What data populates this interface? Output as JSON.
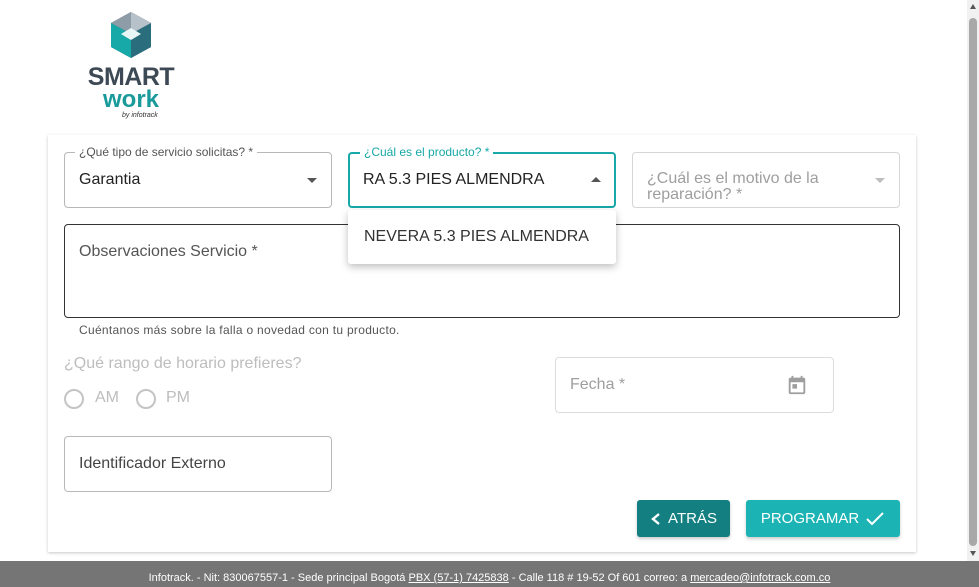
{
  "logo": {
    "line1": "SMART",
    "line2": "work",
    "line3": "by infotrack"
  },
  "form": {
    "service_type": {
      "label": "¿Qué tipo de servicio solicitas? *",
      "value": "Garantia"
    },
    "product": {
      "label": "¿Cuál es el producto? *",
      "value": "RA 5.3 PIES ALMENDRA"
    },
    "reason": {
      "placeholder": "¿Cuál es el motivo de la reparación? *"
    },
    "product_options": [
      "NEVERA 5.3 PIES ALMENDRA"
    ],
    "observations": {
      "placeholder": "Observaciones Servicio *",
      "helper": "Cuéntanos más sobre la falla o novedad con tu producto."
    },
    "schedule": {
      "question": "¿Qué rango de horario prefieres?",
      "options": [
        "AM",
        "PM"
      ]
    },
    "date": {
      "placeholder": "Fecha *"
    },
    "external_id": {
      "placeholder": "Identificador Externo"
    }
  },
  "buttons": {
    "back": "ATRÁS",
    "submit": "PROGRAMAR"
  },
  "footer": {
    "company": "Infotrack. - Nit: 830067557-1 - Sede principal Bogotá",
    "phone": "PBX (57-1) 7425838",
    "address": "- Calle 118 # 19-52 Of 601",
    "email_label": "correo: a",
    "email": "mercadeo@infotrack.com.co"
  },
  "colors": {
    "accent": "#17a8a8",
    "back_button": "#137f80",
    "submit_button": "#1bb3b3",
    "footer": "#757575"
  }
}
